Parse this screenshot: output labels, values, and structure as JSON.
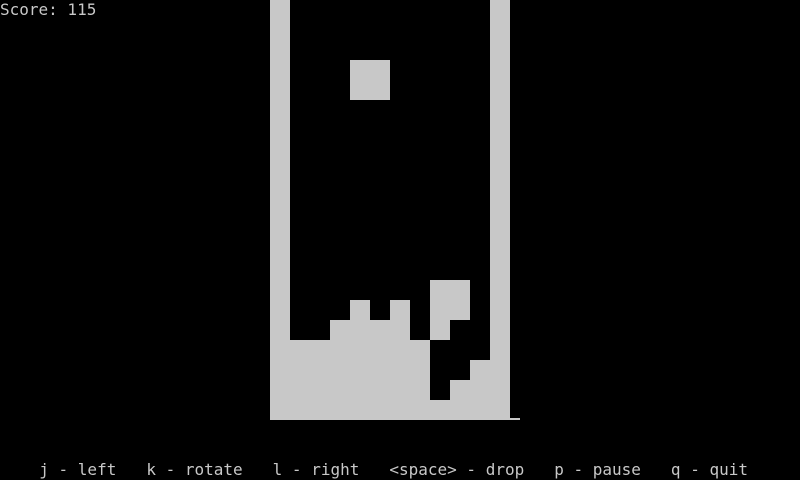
{
  "score_text": "Score: 115",
  "colors": {
    "background": "#000000",
    "foreground": "#c8c8c8"
  },
  "board": {
    "columns": 10,
    "rows": 20,
    "falling_piece": [
      [
        3,
        2
      ],
      [
        4,
        2
      ],
      [
        3,
        3
      ],
      [
        4,
        3
      ]
    ],
    "settled_blocks": [
      [
        7,
        13
      ],
      [
        8,
        13
      ],
      [
        7,
        14
      ],
      [
        8,
        14
      ],
      [
        3,
        14
      ],
      [
        5,
        14
      ],
      [
        2,
        15
      ],
      [
        3,
        15
      ],
      [
        4,
        15
      ],
      [
        5,
        15
      ],
      [
        7,
        15
      ],
      [
        0,
        16
      ],
      [
        1,
        16
      ],
      [
        2,
        16
      ],
      [
        3,
        16
      ],
      [
        4,
        16
      ],
      [
        5,
        16
      ],
      [
        6,
        16
      ],
      [
        0,
        17
      ],
      [
        1,
        17
      ],
      [
        2,
        17
      ],
      [
        3,
        17
      ],
      [
        4,
        17
      ],
      [
        5,
        17
      ],
      [
        6,
        17
      ],
      [
        9,
        17
      ],
      [
        0,
        18
      ],
      [
        1,
        18
      ],
      [
        2,
        18
      ],
      [
        3,
        18
      ],
      [
        4,
        18
      ],
      [
        5,
        18
      ],
      [
        6,
        18
      ],
      [
        8,
        18
      ],
      [
        9,
        18
      ],
      [
        0,
        19
      ],
      [
        1,
        19
      ],
      [
        2,
        19
      ],
      [
        3,
        19
      ],
      [
        4,
        19
      ],
      [
        5,
        19
      ],
      [
        6,
        19
      ],
      [
        7,
        19
      ],
      [
        8,
        19
      ],
      [
        9,
        19
      ]
    ]
  },
  "controls": [
    {
      "text": "j - left"
    },
    {
      "text": "k - rotate"
    },
    {
      "text": "l - right"
    },
    {
      "text": "<space> - drop"
    },
    {
      "text": "p - pause"
    },
    {
      "text": "q - quit"
    }
  ]
}
